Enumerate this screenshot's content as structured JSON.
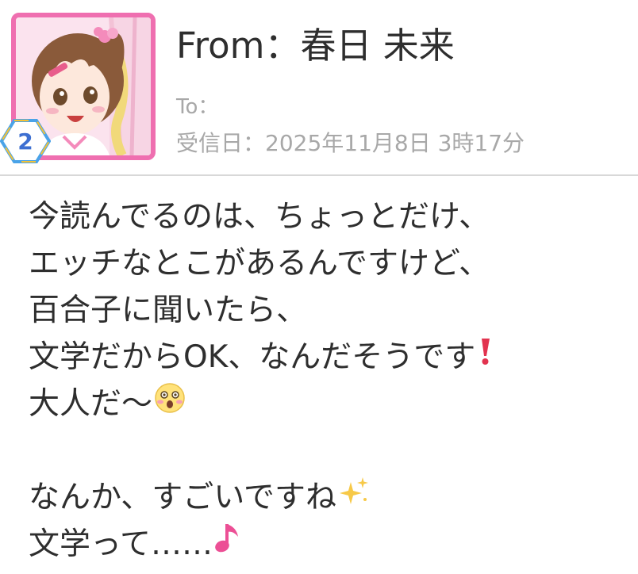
{
  "header": {
    "from_label": "From：",
    "from_name": "春日 未来",
    "to_label": "To：",
    "date_text": "受信日：2025年11月8日 3時17分",
    "rank_badge_text": "2"
  },
  "message": {
    "lines": [
      "今読んでるのは、ちょっとだけ、",
      "エッチなとこがあるんですけど、",
      "百合子に聞いたら、",
      "文学だからOK、なんだそうです",
      "大人だ～",
      "",
      "なんか、すごいですね",
      "文学って……"
    ],
    "emojis": {
      "line4": "exclamation-icon",
      "line5": "surprised-face-icon",
      "line7": "sparkles-icon",
      "line8": "music-note-icon"
    }
  },
  "colors": {
    "frame": "#ef6fb0",
    "text": "#2e2e2e",
    "muted": "#a8a8a8",
    "divider": "#d8d8d8"
  }
}
